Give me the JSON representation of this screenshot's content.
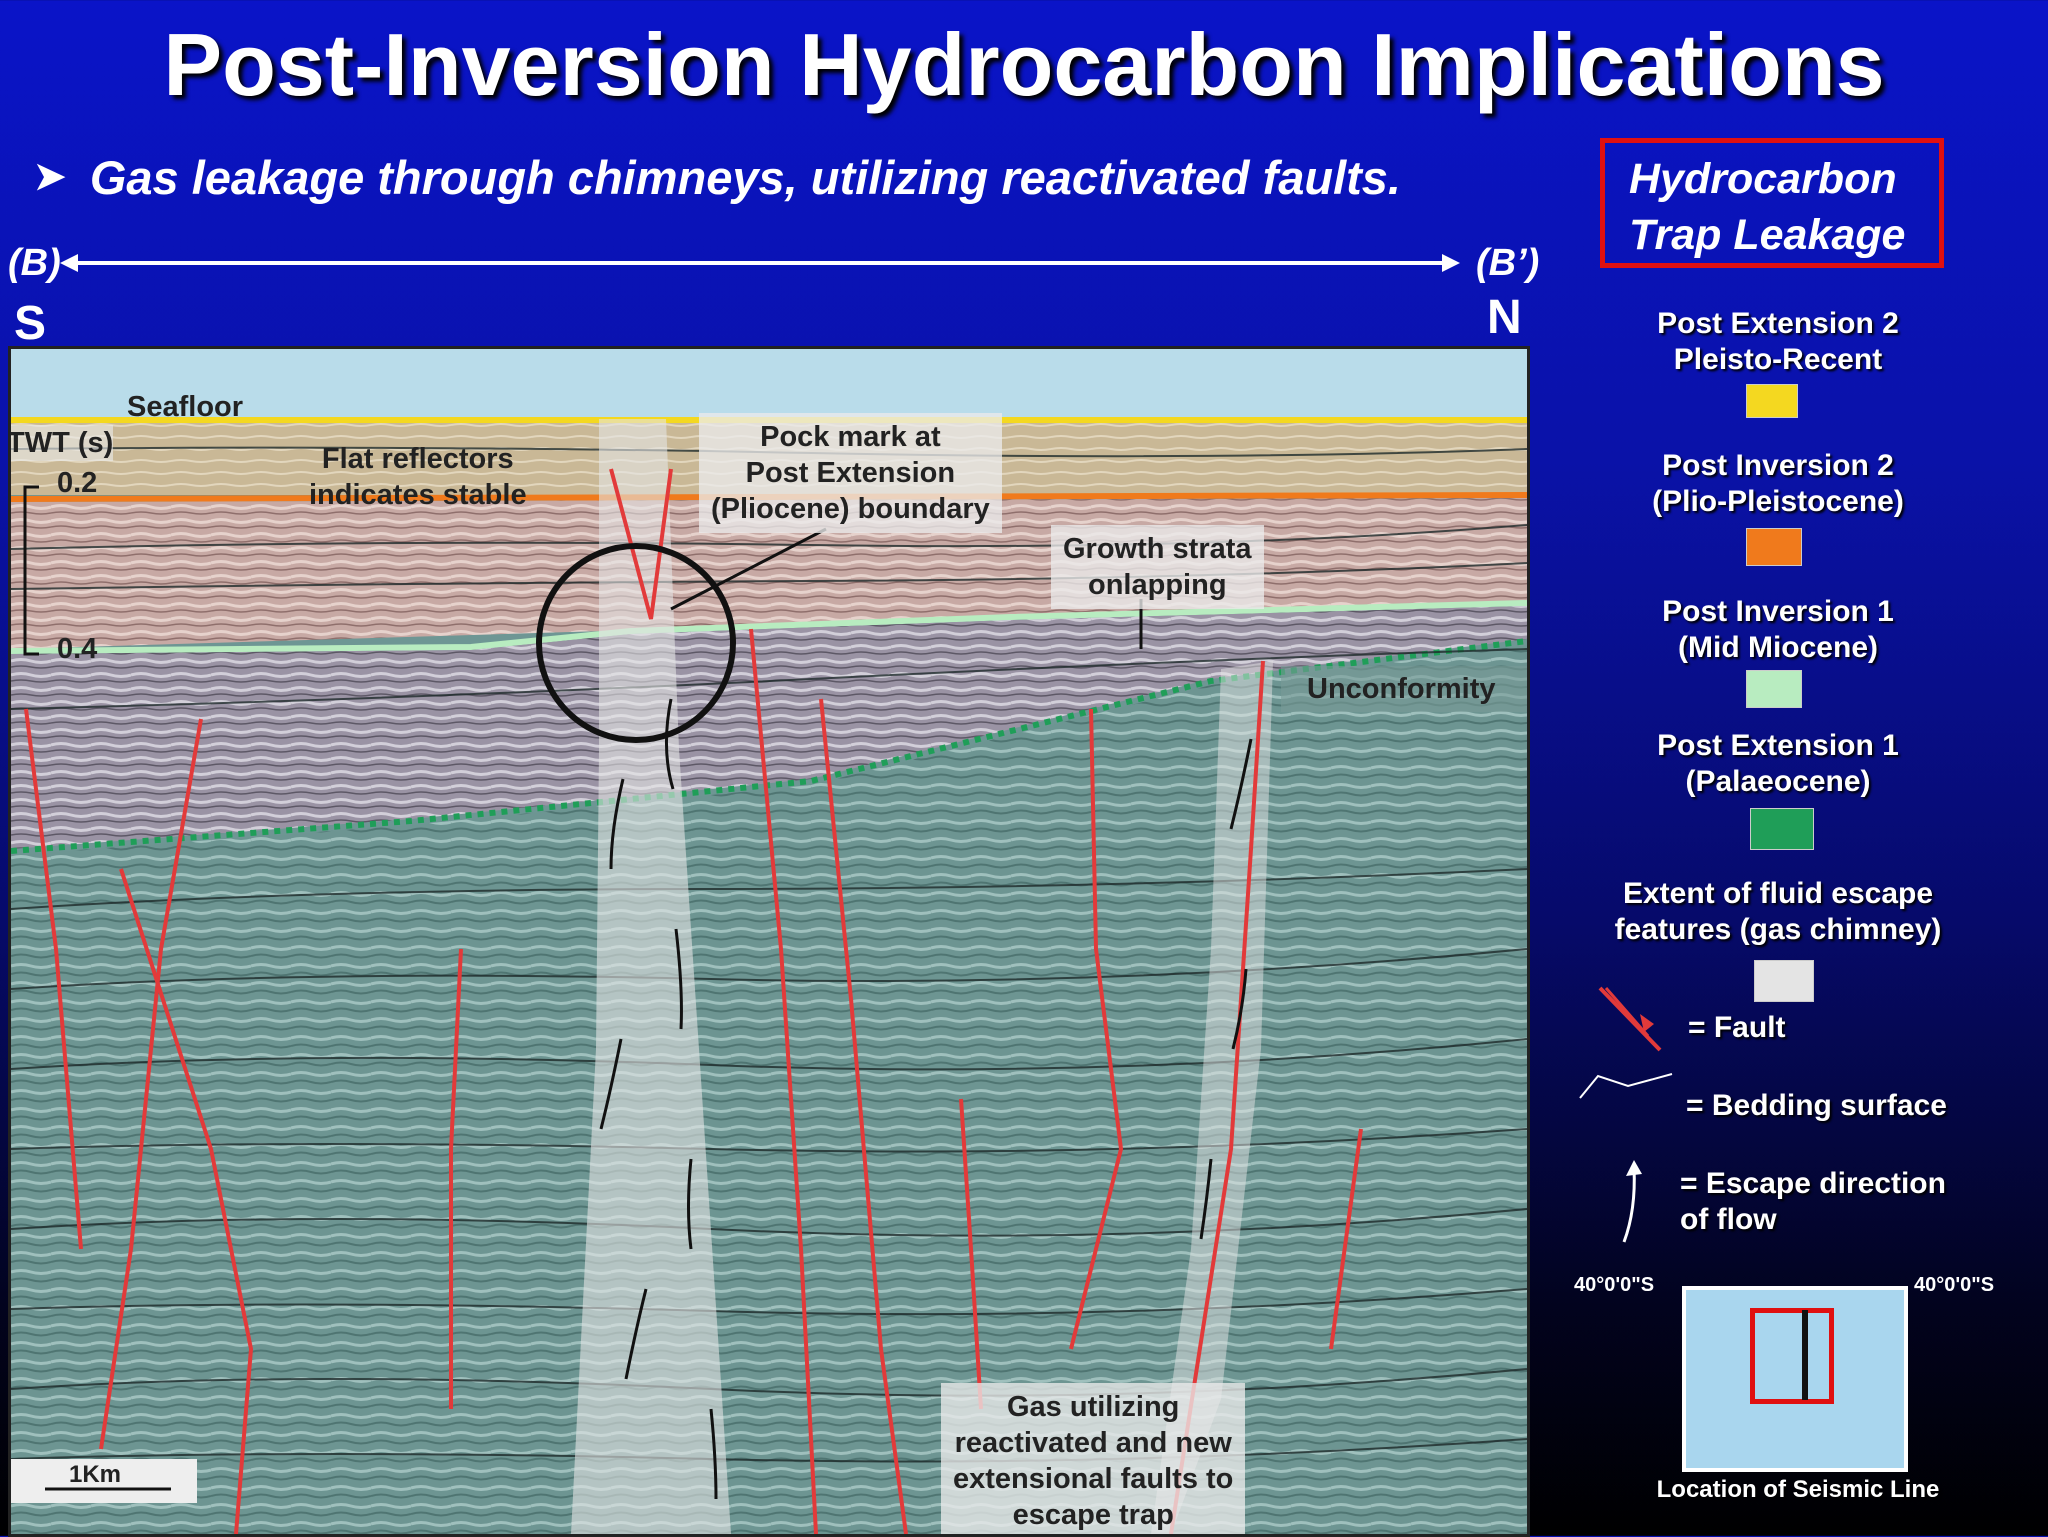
{
  "title": "Post-Inversion Hydrocarbon Implications",
  "bullet": "Gas leakage through chimneys, utilizing reactivated faults.",
  "section_ends": {
    "left_label": "(B)",
    "left_dir": "S",
    "right_label": "(B’)",
    "right_dir": "N"
  },
  "trap_box": {
    "line1": "Hydrocarbon",
    "line2": "Trap Leakage",
    "border_color": "#e01010"
  },
  "seismic": {
    "seafloor": "Seafloor",
    "twt_label": "TWT (s)",
    "twt_ticks": [
      "0.2",
      "0.4"
    ],
    "flat_reflectors": [
      "Flat reflectors",
      "indicates stable"
    ],
    "pock_mark": [
      "Pock mark at",
      "Post Extension",
      "(Pliocene) boundary"
    ],
    "growth_strata": [
      "Growth strata",
      "onlapping"
    ],
    "unconformity": "Unconformity",
    "gas_note": [
      "Gas utilizing",
      "reactivated and new",
      "extensional faults to",
      "escape trap"
    ],
    "scale_bar": "1Km"
  },
  "legend": {
    "units": [
      {
        "line1": "Post Extension 2",
        "line2": "Pleisto-Recent",
        "color": "#f4d820"
      },
      {
        "line1": "Post Inversion 2",
        "line2": "(Plio-Pleistocene)",
        "color": "#f07a1c"
      },
      {
        "line1": "Post Inversion 1",
        "line2": "(Mid Miocene)",
        "color": "#b8ecc0"
      },
      {
        "line1": "Post Extension 1",
        "line2": "(Palaeocene)",
        "color": "#1f9e58"
      },
      {
        "line1": "Extent of fluid escape",
        "line2": "features (gas chimney)",
        "color": "#e4e4e4"
      }
    ],
    "fault": "= Fault",
    "bedding": "= Bedding surface",
    "escape1": "= Escape direction",
    "escape2": "of flow",
    "location": {
      "lat_left": "40°0'0\"S",
      "lat_right": "40°0'0\"S",
      "caption": "Location of Seismic Line"
    }
  }
}
